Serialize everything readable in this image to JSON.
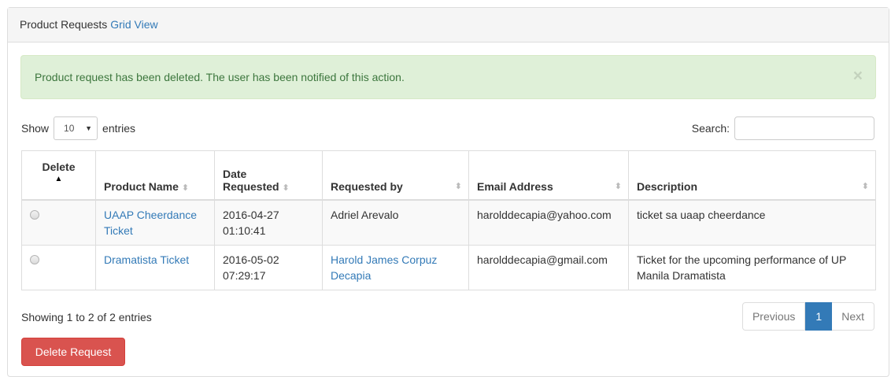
{
  "header": {
    "title": "Product Requests",
    "link": "Grid View"
  },
  "alert": {
    "message": "Product request has been deleted. The user has been notified of this action.",
    "close": "×"
  },
  "length": {
    "show_label": "Show",
    "value": "10",
    "entries_label": "entries"
  },
  "search": {
    "label": "Search:",
    "value": ""
  },
  "table": {
    "columns": [
      "Delete",
      "Product Name",
      "Date Requested",
      "Requested by",
      "Email Address",
      "Description"
    ],
    "date_col_line1": "Date",
    "date_col_line2": "Requested",
    "rows": [
      {
        "product_line1": "UAAP Cheerdance",
        "product_line2": "Ticket",
        "date": "2016-04-27",
        "time": "01:10:41",
        "requested_by": "Adriel Arevalo",
        "email": "harolddecapia@yahoo.com",
        "description": "ticket sa uaap cheerdance"
      },
      {
        "product_line1": "Dramatista Ticket",
        "date": "2016-05-02",
        "time": "07:29:17",
        "requested_by_line1": "Harold James Corpuz",
        "requested_by_line2": "Decapia",
        "email": "harolddecapia@gmail.com",
        "description_line1": "Ticket for the upcoming performance of UP",
        "description_line2": "Manila Dramatista"
      }
    ]
  },
  "info": "Showing 1 to 2 of 2 entries",
  "pagination": {
    "previous": "Previous",
    "current": "1",
    "next": "Next"
  },
  "actions": {
    "delete_label": "Delete Request"
  },
  "colors": {
    "primary": "#337ab7",
    "danger": "#d9534f",
    "success_bg": "#dff0d8",
    "success_text": "#3c763d"
  }
}
